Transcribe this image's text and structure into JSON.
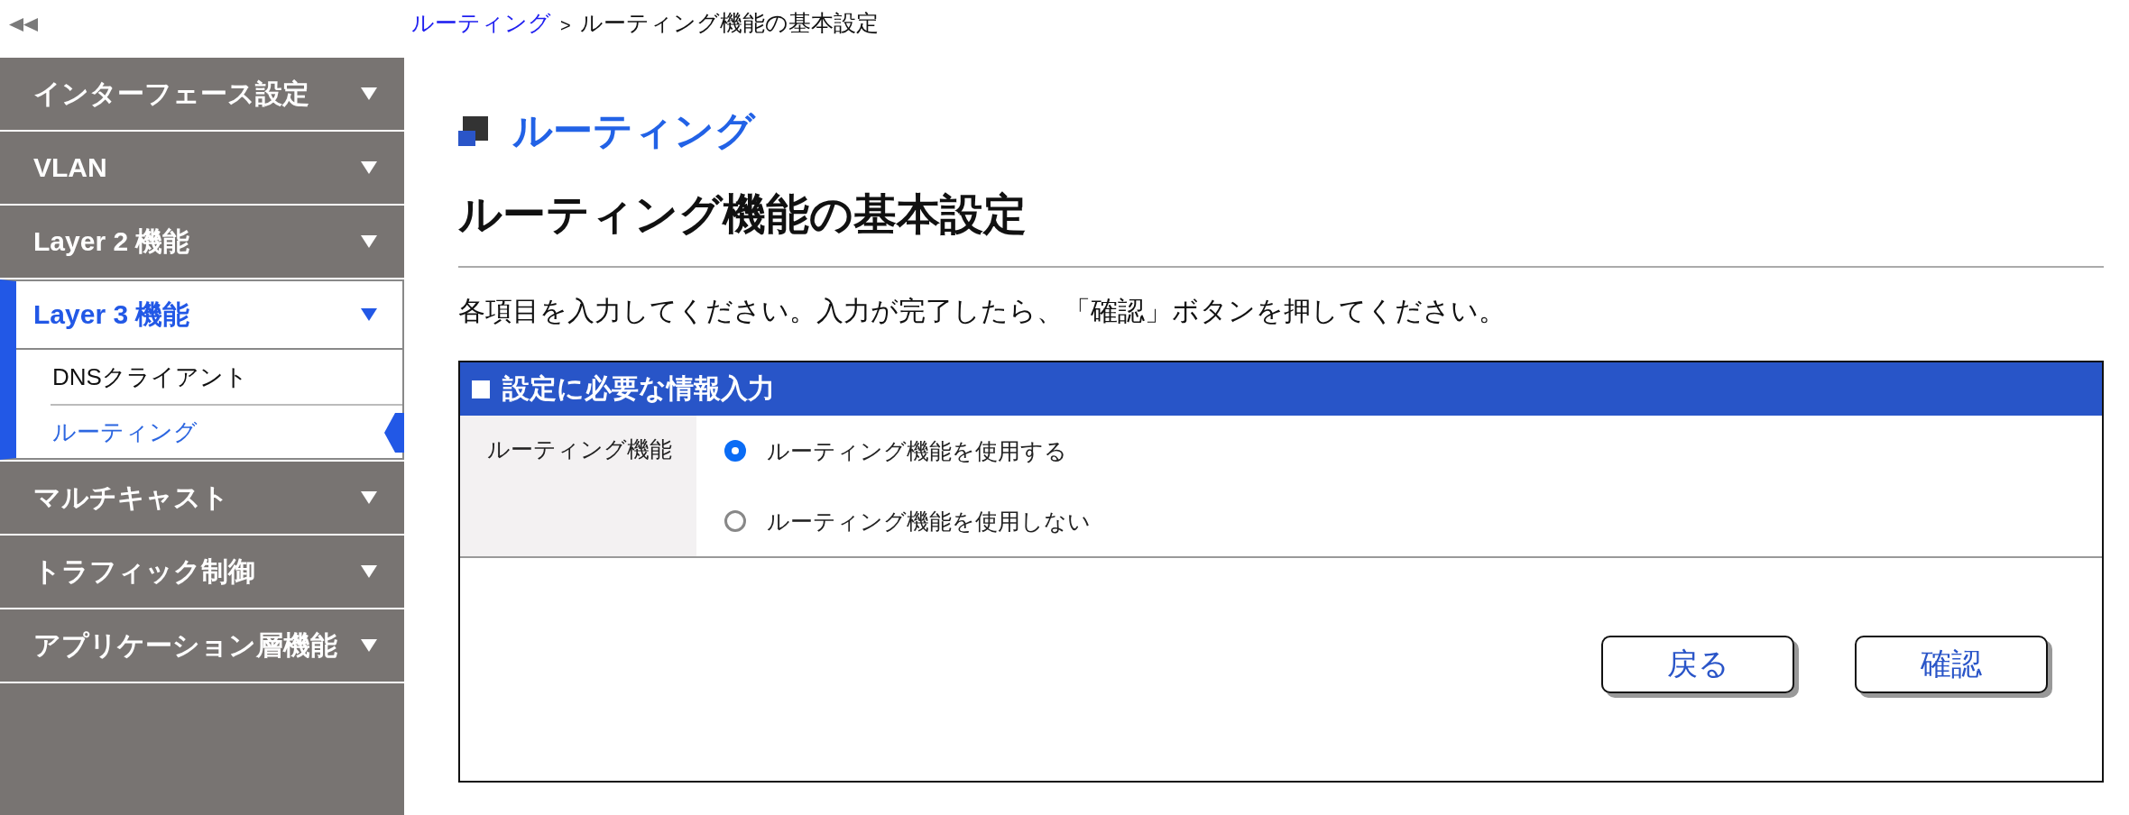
{
  "sidebar": {
    "items": [
      {
        "label": "インターフェース設定",
        "selected": false
      },
      {
        "label": "VLAN",
        "selected": false
      },
      {
        "label": "Layer 2 機能",
        "selected": false
      },
      {
        "label": "Layer 3 機能",
        "selected": true,
        "children": [
          {
            "label": "DNSクライアント",
            "selected": false
          },
          {
            "label": "ルーティング",
            "selected": true
          }
        ]
      },
      {
        "label": "マルチキャスト",
        "selected": false
      },
      {
        "label": "トラフィック制御",
        "selected": false
      },
      {
        "label": "アプリケーション層機能",
        "selected": false
      }
    ]
  },
  "breadcrumb": {
    "items": [
      {
        "label": "ルーティング",
        "kind": "link"
      },
      {
        "label": "ルーティング機能の基本設定",
        "kind": "current"
      }
    ],
    "separator": ">"
  },
  "section": {
    "title": "ルーティング"
  },
  "page_title": "ルーティング機能の基本設定",
  "instructions": "各項目を入力してください。入力が完了したら、「確認」ボタンを押してください。",
  "form": {
    "header": "設定に必要な情報入力",
    "rows": [
      {
        "label": "ルーティング機能",
        "options": [
          {
            "label": "ルーティング機能を使用する",
            "selected": true
          },
          {
            "label": "ルーティング機能を使用しない",
            "selected": false
          }
        ]
      }
    ],
    "buttons": [
      {
        "label": "戻る"
      },
      {
        "label": "確認"
      }
    ]
  }
}
